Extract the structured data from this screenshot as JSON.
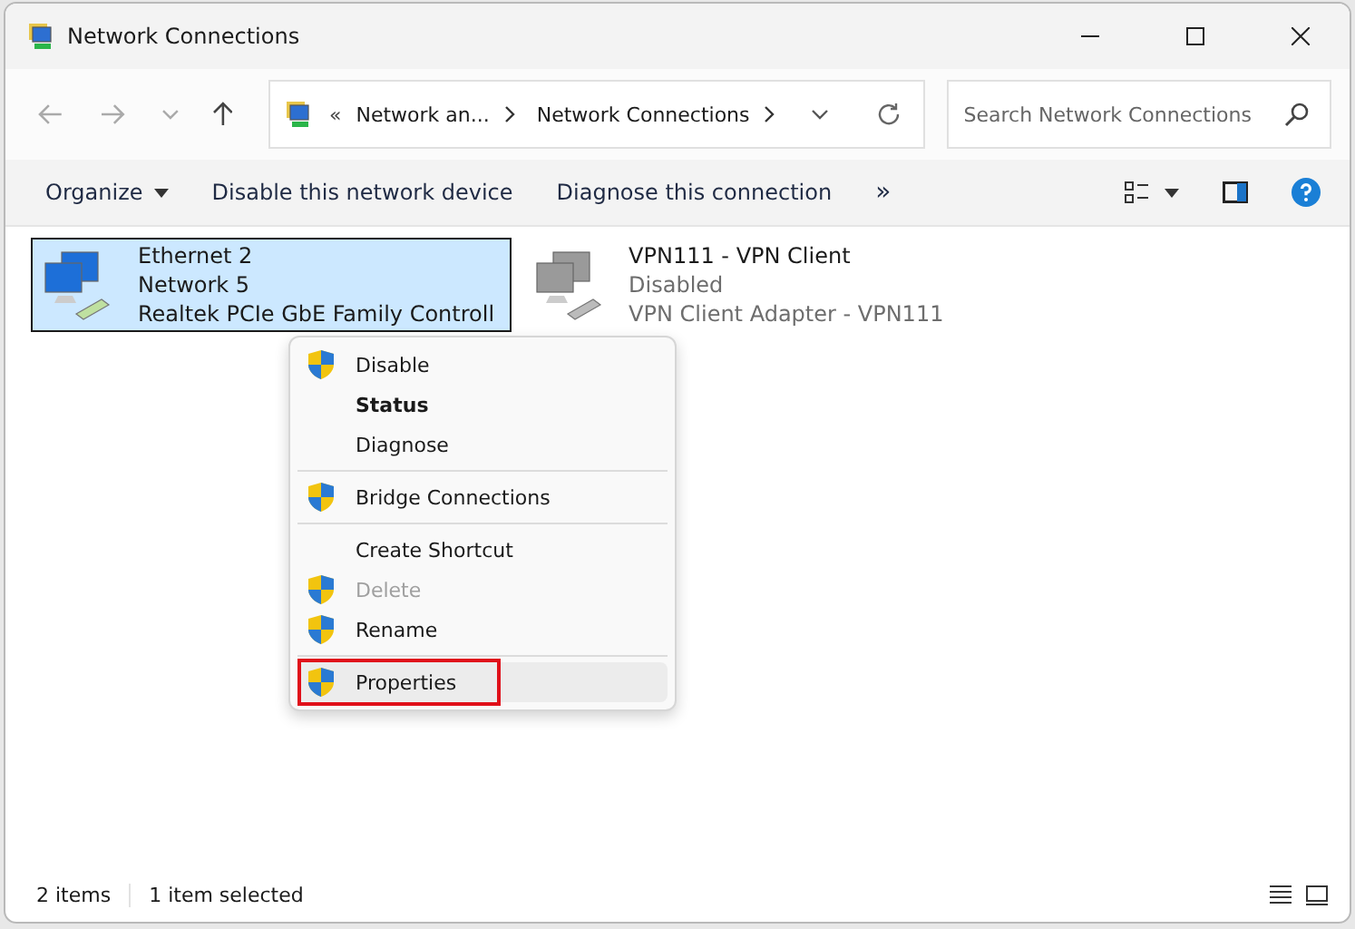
{
  "window": {
    "title": "Network Connections"
  },
  "address": {
    "overflow": "«",
    "crumbs": [
      "Network an...",
      "Network Connections"
    ]
  },
  "search": {
    "placeholder": "Search Network Connections"
  },
  "commands": [
    {
      "label": "Organize",
      "dropdown": true
    },
    {
      "label": "Disable this network device",
      "dropdown": false
    },
    {
      "label": "Diagnose this connection",
      "dropdown": false
    }
  ],
  "more": "»",
  "connections": [
    {
      "name": "Ethernet 2",
      "status": "Network 5",
      "device": "Realtek PCIe GbE Family Controll",
      "selected": true,
      "enabled": true
    },
    {
      "name": "VPN111 - VPN Client",
      "status": "Disabled",
      "device": "VPN Client Adapter - VPN111",
      "selected": false,
      "enabled": false
    }
  ],
  "context_menu": {
    "items": [
      {
        "kind": "item",
        "label": "Disable",
        "shield": true,
        "bold": false,
        "disabled": false,
        "selected": false,
        "annotated": false
      },
      {
        "kind": "item",
        "label": "Status",
        "shield": false,
        "bold": true,
        "disabled": false,
        "selected": false,
        "annotated": false
      },
      {
        "kind": "item",
        "label": "Diagnose",
        "shield": false,
        "bold": false,
        "disabled": false,
        "selected": false,
        "annotated": false
      },
      {
        "kind": "separator"
      },
      {
        "kind": "item",
        "label": "Bridge Connections",
        "shield": true,
        "bold": false,
        "disabled": false,
        "selected": false,
        "annotated": false
      },
      {
        "kind": "separator"
      },
      {
        "kind": "item",
        "label": "Create Shortcut",
        "shield": false,
        "bold": false,
        "disabled": false,
        "selected": false,
        "annotated": false
      },
      {
        "kind": "item",
        "label": "Delete",
        "shield": true,
        "bold": false,
        "disabled": true,
        "selected": false,
        "annotated": false
      },
      {
        "kind": "item",
        "label": "Rename",
        "shield": true,
        "bold": false,
        "disabled": false,
        "selected": false,
        "annotated": false
      },
      {
        "kind": "separator"
      },
      {
        "kind": "item",
        "label": "Properties",
        "shield": true,
        "bold": false,
        "disabled": false,
        "selected": true,
        "annotated": true
      }
    ]
  },
  "status_bar": {
    "count": "2 items",
    "selection": "1 item selected"
  }
}
